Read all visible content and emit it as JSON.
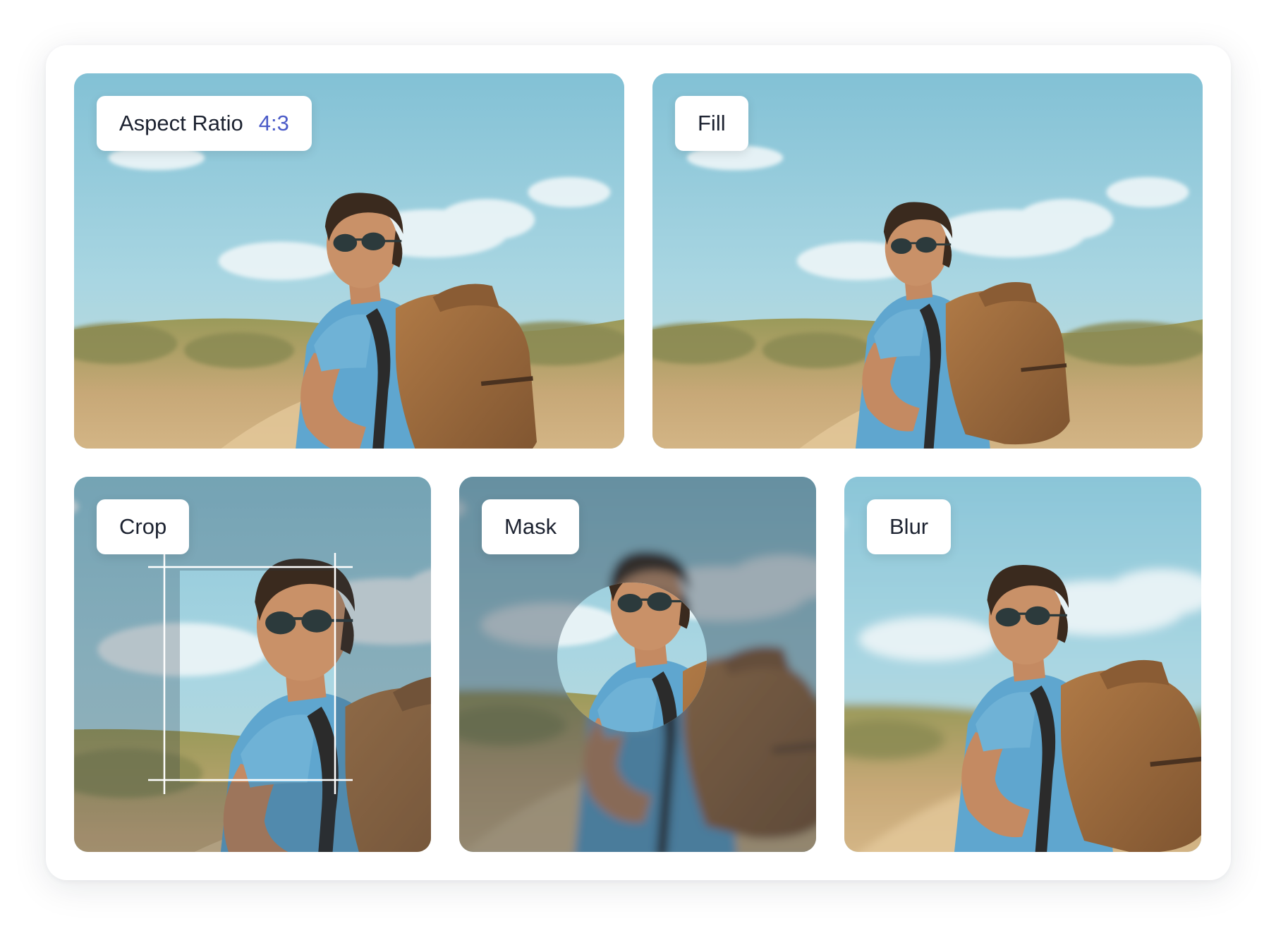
{
  "tiles": {
    "aspect_ratio": {
      "label": "Aspect Ratio",
      "value": "4:3"
    },
    "fill": {
      "label": "Fill"
    },
    "crop": {
      "label": "Crop"
    },
    "mask": {
      "label": "Mask"
    },
    "blur": {
      "label": "Blur"
    }
  },
  "colors": {
    "ratio_accent": "#4b5bc8",
    "label_text": "#1c2230",
    "sky": "#8ec6d6",
    "shirt": "#5fa6cf",
    "backpack": "#9c6a3e"
  }
}
